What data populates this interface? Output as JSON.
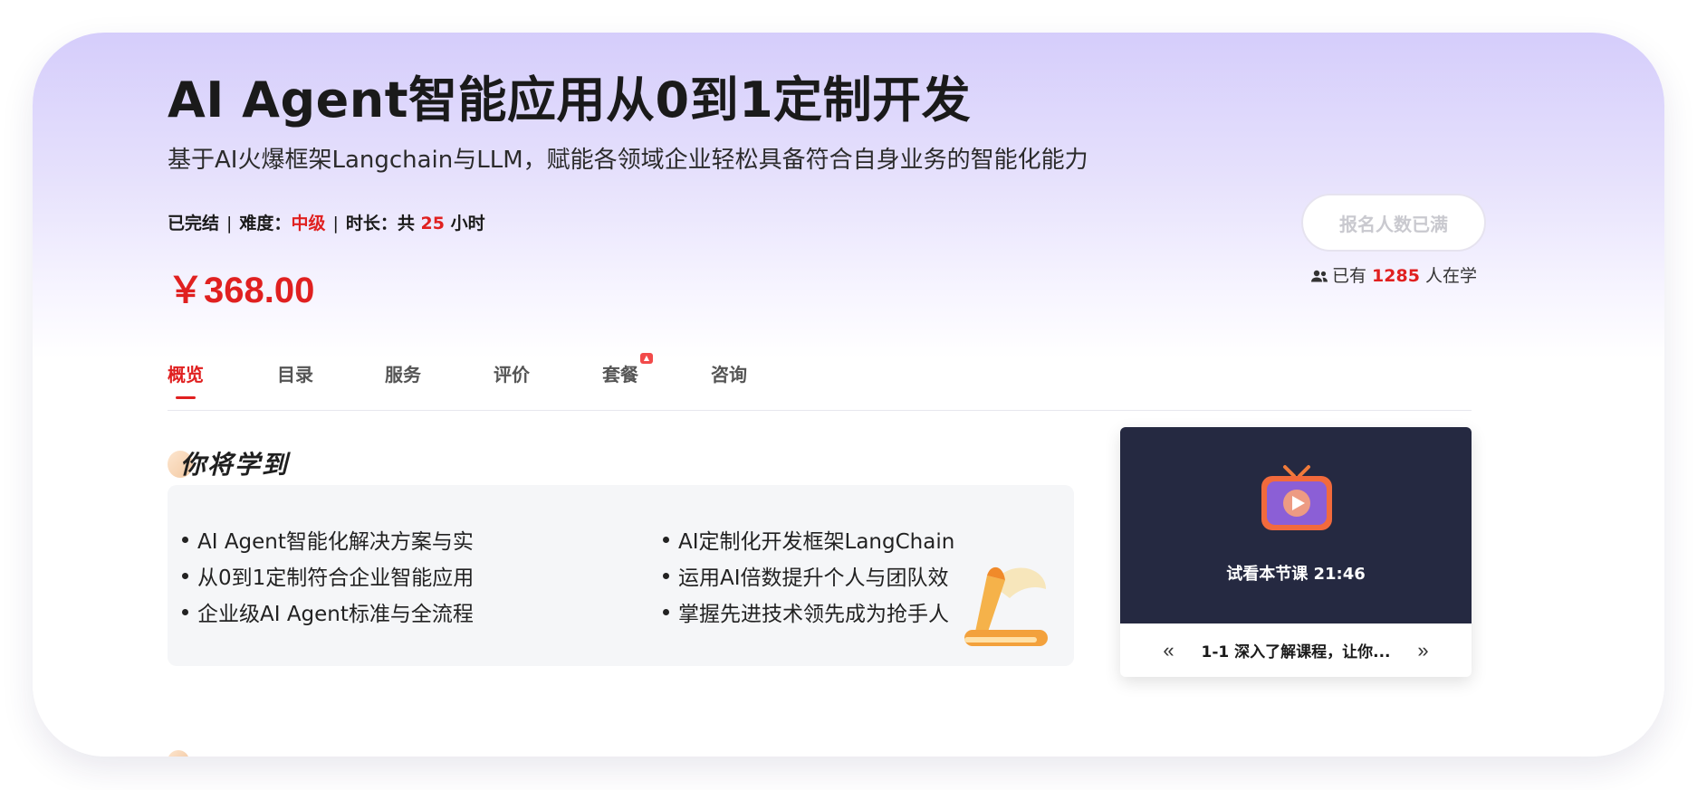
{
  "course": {
    "title": "AI Agent智能应用从0到1定制开发",
    "subtitle": "基于AI火爆框架Langchain与LLM，赋能各领域企业轻松具备符合自身业务的智能化能力",
    "meta": {
      "status": "已完结",
      "separator": "|",
      "difficulty_label": "难度：",
      "difficulty_value": "中级",
      "duration_label": "时长：共",
      "duration_value": "25",
      "duration_unit": "小时"
    },
    "price": "￥368.00"
  },
  "enroll": {
    "button_label": "报名人数已满",
    "learners_prefix": "已有",
    "learners_count": "1285",
    "learners_suffix": "人在学",
    "icon": "people-icon"
  },
  "tabs": [
    {
      "label": "概览",
      "active": true
    },
    {
      "label": "目录",
      "active": false
    },
    {
      "label": "服务",
      "active": false
    },
    {
      "label": "评价",
      "active": false
    },
    {
      "label": "套餐",
      "active": false,
      "badge": "hot"
    },
    {
      "label": "咨询",
      "active": false
    }
  ],
  "learn": {
    "heading": "你将学到",
    "left_items": [
      "AI Agent智能化解决方案与实",
      "从0到1定制符合企业智能应用",
      "企业级AI Agent标准与全流程"
    ],
    "right_items": [
      "AI定制化开发框架LangChain",
      "运用AI倍数提升个人与团队效",
      "掌握先进技术领先成为抢手人"
    ]
  },
  "video": {
    "trial_label": "试看本节课 21:46",
    "lesson_title": "1-1 深入了解课程，让你...",
    "prev_icon": "«",
    "next_icon": "»"
  },
  "colors": {
    "accent": "#e02020",
    "header_gradient_top": "#d5cdfb",
    "video_bg": "#252941",
    "panel_bg": "#f5f6f8"
  }
}
